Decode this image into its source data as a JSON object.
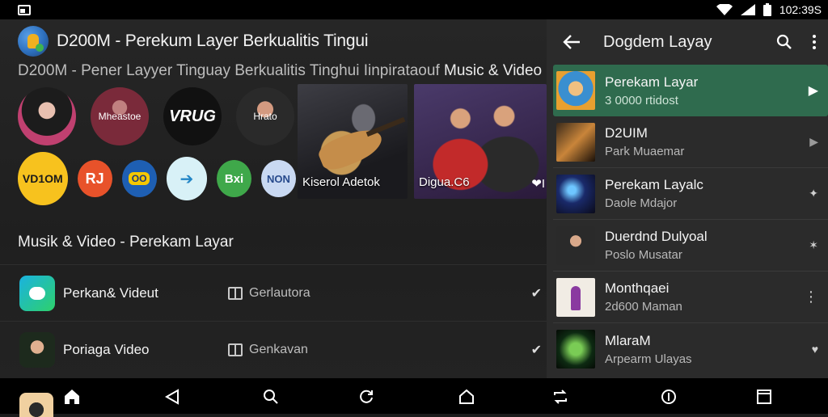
{
  "status": {
    "time": "102:39S"
  },
  "app": {
    "title": "D200M - Perekum Layer Berkualitis Tingui",
    "subtitle_main": "D200M - Pener Layyer Tinguay Berkualitis Tinghui Iinpirataouf",
    "subtitle_tail": "Music & Video"
  },
  "artists": [
    {
      "label": ""
    },
    {
      "label": "Mheastoe"
    },
    {
      "label": "VRUG"
    },
    {
      "label": "Hrato"
    }
  ],
  "app_chips": [
    {
      "label": "VD1OM"
    },
    {
      "label": "RJ"
    },
    {
      "label": "OO"
    },
    {
      "label": "➔"
    },
    {
      "label": "Bxi"
    },
    {
      "label": "NON"
    }
  ],
  "videos": [
    {
      "label": "Kiserol Adetok"
    },
    {
      "label": "Digua.C6"
    }
  ],
  "section": {
    "title": "Musik & Video - Perekam Layar"
  },
  "list": [
    {
      "title": "Perkan& Videut",
      "meta": "Gerlautora"
    },
    {
      "title": "Poriaga Video",
      "meta": "Genkavan"
    }
  ],
  "panel": {
    "title": "Dogdem Layay",
    "tracks": [
      {
        "title": "Perekam Layar",
        "sub": "3 0000 rtidost",
        "action": "▶"
      },
      {
        "title": "D2UIM",
        "sub": "Park Muaemar",
        "action": "▶"
      },
      {
        "title": "Perekam Layalc",
        "sub": "Daole Mdajor",
        "action": "✦"
      },
      {
        "title": "Duerdnd Dulyoal",
        "sub": "Poslo Musatar",
        "action": "✶"
      },
      {
        "title": "Monthqaei",
        "sub": "2d600 Maman",
        "action": "⋮"
      },
      {
        "title": "MlaraM",
        "sub": "Arpearm Ulayas",
        "action": "♥"
      }
    ]
  }
}
